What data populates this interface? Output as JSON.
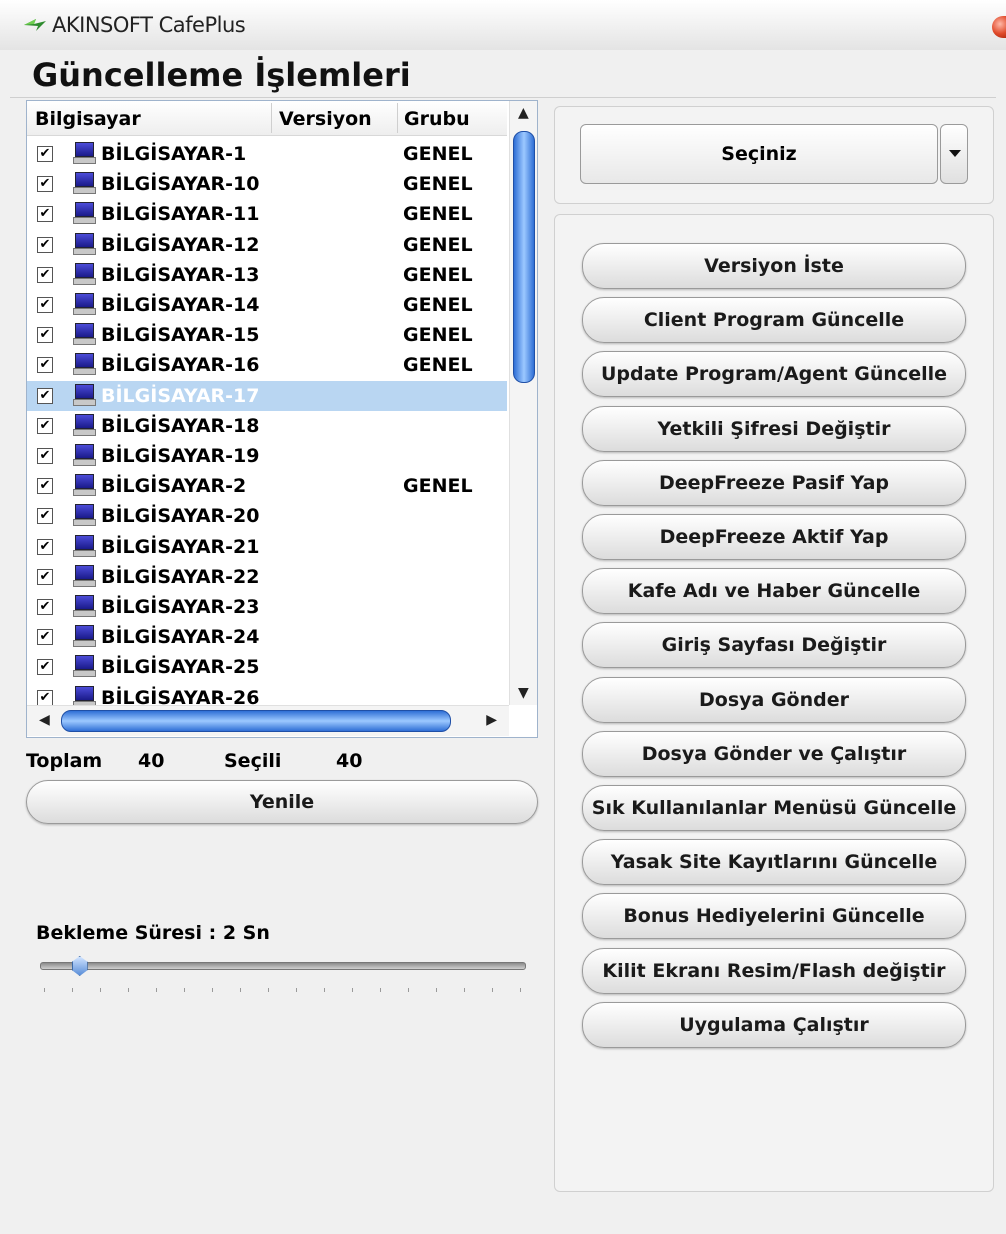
{
  "window": {
    "title": "AKINSOFT CafePlus"
  },
  "page_title": "Güncelleme İşlemleri",
  "list": {
    "columns": [
      "Bilgisayar",
      "Versiyon",
      "Grubu"
    ],
    "rows": [
      {
        "name": "BİLGİSAYAR-1",
        "group": "GENEL"
      },
      {
        "name": "BİLGİSAYAR-10",
        "group": "GENEL"
      },
      {
        "name": "BİLGİSAYAR-11",
        "group": "GENEL"
      },
      {
        "name": "BİLGİSAYAR-12",
        "group": "GENEL"
      },
      {
        "name": "BİLGİSAYAR-13",
        "group": "GENEL"
      },
      {
        "name": "BİLGİSAYAR-14",
        "group": "GENEL"
      },
      {
        "name": "BİLGİSAYAR-15",
        "group": "GENEL"
      },
      {
        "name": "BİLGİSAYAR-16",
        "group": "GENEL"
      },
      {
        "name": "BİLGİSAYAR-17",
        "group": ""
      },
      {
        "name": "BİLGİSAYAR-18",
        "group": ""
      },
      {
        "name": "BİLGİSAYAR-19",
        "group": ""
      },
      {
        "name": "BİLGİSAYAR-2",
        "group": "GENEL"
      },
      {
        "name": "BİLGİSAYAR-20",
        "group": ""
      },
      {
        "name": "BİLGİSAYAR-21",
        "group": ""
      },
      {
        "name": "BİLGİSAYAR-22",
        "group": ""
      },
      {
        "name": "BİLGİSAYAR-23",
        "group": ""
      },
      {
        "name": "BİLGİSAYAR-24",
        "group": ""
      },
      {
        "name": "BİLGİSAYAR-25",
        "group": ""
      },
      {
        "name": "BİLGİSAYAR-26",
        "group": ""
      }
    ],
    "selected_row": 8
  },
  "stats": {
    "total_label": "Toplam",
    "total_value": "40",
    "selected_label": "Seçili",
    "selected_value": "40"
  },
  "refresh_label": "Yenile",
  "wait": {
    "label": "Bekleme Süresi : 2 Sn",
    "slider_fraction": 0.08
  },
  "combo": {
    "value": "Seçiniz"
  },
  "actions": [
    "Versiyon İste",
    "Client Program Güncelle",
    "Update Program/Agent Güncelle",
    "Yetkili Şifresi Değiştir",
    "DeepFreeze Pasif Yap",
    "DeepFreeze Aktif Yap",
    "Kafe Adı ve Haber Güncelle",
    "Giriş Sayfası Değiştir",
    "Dosya Gönder",
    "Dosya Gönder ve Çalıştır",
    "Sık Kullanılanlar Menüsü Güncelle",
    "Yasak Site Kayıtlarını Güncelle",
    "Bonus Hediyelerini Güncelle",
    "Kilit Ekranı Resim/Flash değiştir",
    "Uygulama Çalıştır"
  ]
}
